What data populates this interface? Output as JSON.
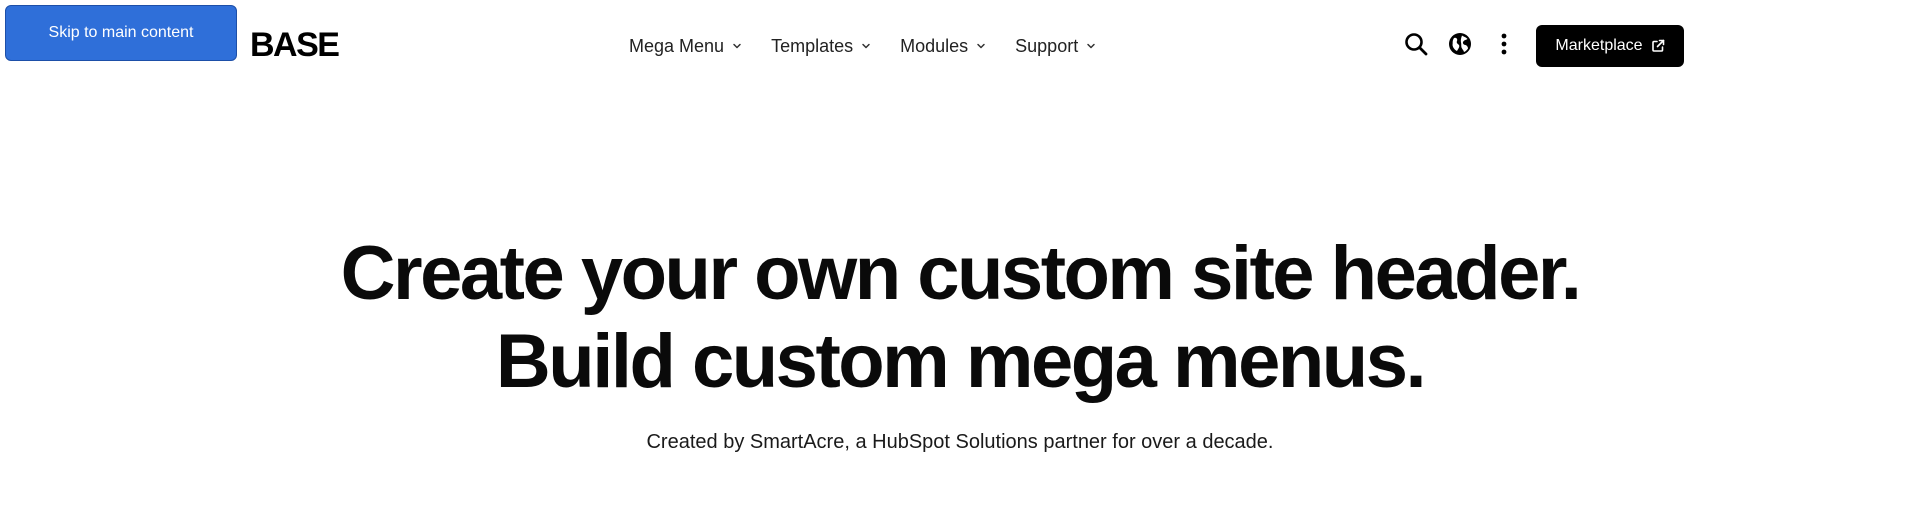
{
  "skip_link": {
    "label": "Skip to main content"
  },
  "brand": {
    "logo_text": "BASE"
  },
  "nav": {
    "items": [
      {
        "label": "Mega Menu",
        "icon": "chevron-down-icon"
      },
      {
        "label": "Templates",
        "icon": "chevron-down-icon"
      },
      {
        "label": "Modules",
        "icon": "chevron-down-icon"
      },
      {
        "label": "Support",
        "icon": "chevron-down-icon"
      }
    ]
  },
  "utility": {
    "icons": [
      "search-icon",
      "globe-icon",
      "more-vertical-icon"
    ]
  },
  "cta": {
    "label": "Marketplace",
    "icon": "external-link-icon"
  },
  "hero": {
    "title_line_1": "Create your own custom site header.",
    "title_line_2": "Build custom mega menus.",
    "subtitle": "Created by SmartAcre, a HubSpot Solutions partner for over a decade."
  },
  "colors": {
    "skip_link_bg": "#2f6fd9",
    "cta_bg": "#000000",
    "text": "#0a0a0a",
    "background": "#ffffff"
  }
}
